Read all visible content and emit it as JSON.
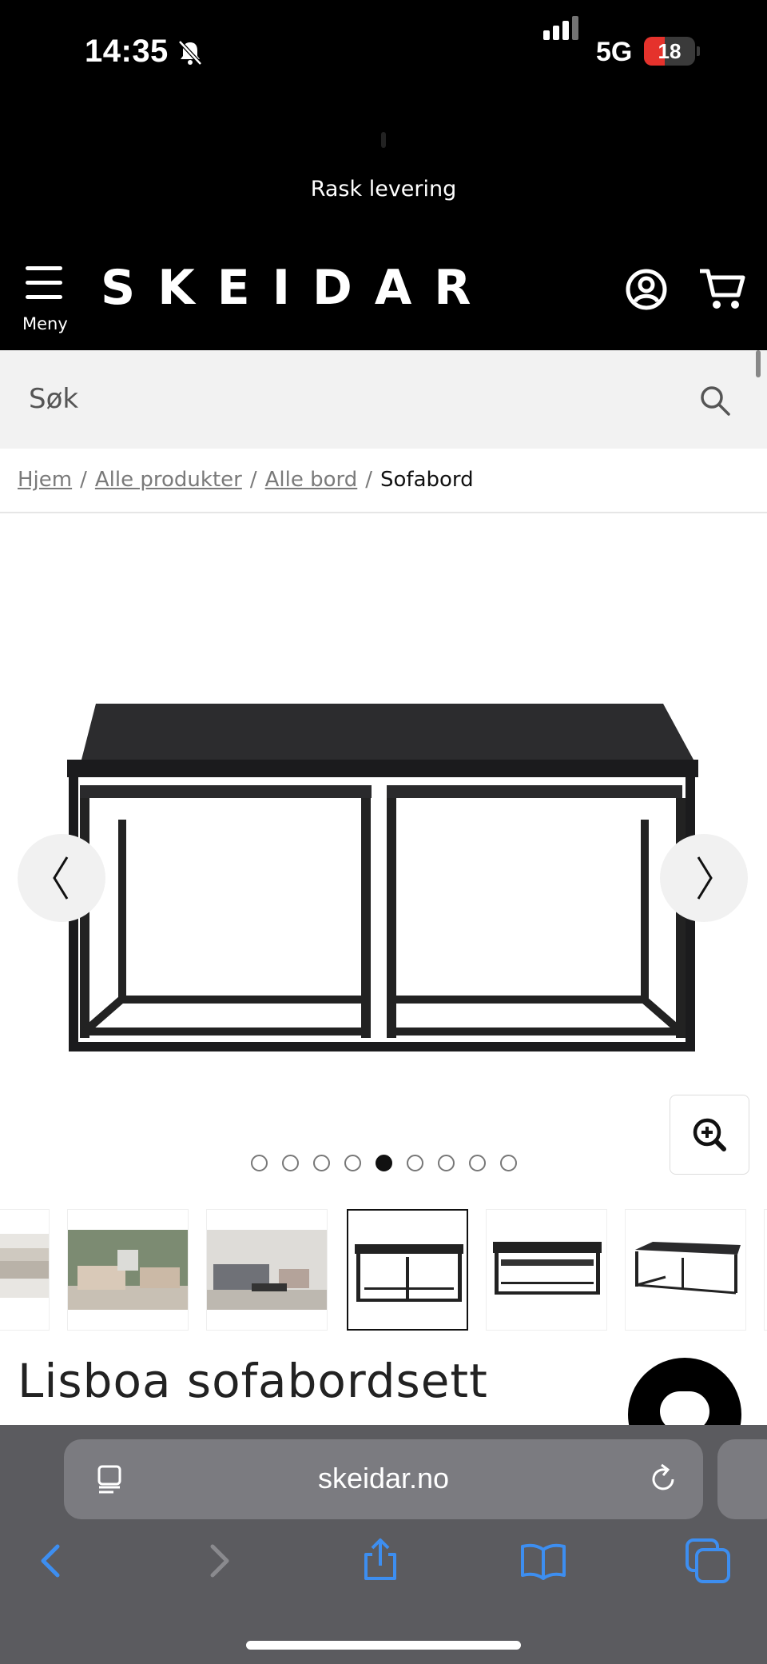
{
  "status_bar": {
    "time": "14:35",
    "network": "5G",
    "battery": "18",
    "battery_level_percent": 18
  },
  "announcement": {
    "text": "Rask levering"
  },
  "header": {
    "menu_label": "Meny",
    "logo": "SKEIDAR",
    "icons": [
      "account-icon",
      "cart-icon"
    ]
  },
  "search": {
    "placeholder": "Søk"
  },
  "breadcrumb": {
    "items": [
      "Hjem",
      "Alle produkter",
      "Alle bord"
    ],
    "current": "Sofabord"
  },
  "gallery": {
    "total_images": 9,
    "active_index": 4
  },
  "product": {
    "title": "Lisboa sofabordsett"
  },
  "browser": {
    "url": "skeidar.no"
  },
  "colors": {
    "brand": "#000000",
    "accent_ios": "#3d8ef0",
    "battery_low": "#e5322c"
  }
}
